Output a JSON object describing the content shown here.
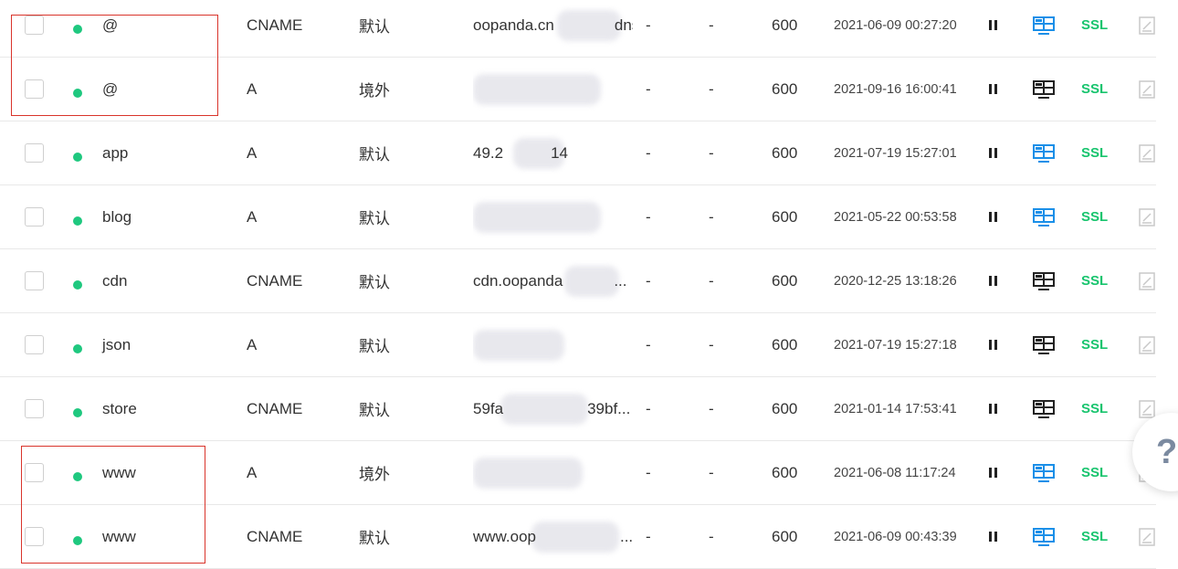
{
  "colors": {
    "status_dot": "#1fc87f",
    "ssl": "#18c46e",
    "monitor_active": "#1a8fe8",
    "monitor_inactive": "#222222",
    "highlight_box": "#d9342b",
    "edit_icon": "#c8c8c8",
    "help_icon": "#7b8aa0"
  },
  "icons": {
    "status": "status-dot-icon",
    "pause": "pause-icon",
    "monitor": "monitor-grid-icon",
    "edit": "edit-icon",
    "help": "question-mark-icon"
  },
  "ssl_label": "SSL",
  "help_label": "?",
  "records": [
    {
      "host": "@",
      "type": "CNAME",
      "line": "默认",
      "value": "oopanda.cn",
      "value_suffix": "dns...",
      "mx": "-",
      "weight": "-",
      "ttl": "600",
      "updated": "2021-06-09 00:27:20",
      "monitor_active": true
    },
    {
      "host": "@",
      "type": "A",
      "line": "境外",
      "value": "",
      "value_suffix": "",
      "mx": "-",
      "weight": "-",
      "ttl": "600",
      "updated": "2021-09-16 16:00:41",
      "monitor_active": false
    },
    {
      "host": "app",
      "type": "A",
      "line": "默认",
      "value": "49.2",
      "value_suffix": "14",
      "mx": "-",
      "weight": "-",
      "ttl": "600",
      "updated": "2021-07-19 15:27:01",
      "monitor_active": true
    },
    {
      "host": "blog",
      "type": "A",
      "line": "默认",
      "value": "",
      "value_suffix": "",
      "mx": "-",
      "weight": "-",
      "ttl": "600",
      "updated": "2021-05-22 00:53:58",
      "monitor_active": true
    },
    {
      "host": "cdn",
      "type": "CNAME",
      "line": "默认",
      "value": "cdn.oopanda",
      "value_suffix": "...",
      "mx": "-",
      "weight": "-",
      "ttl": "600",
      "updated": "2020-12-25 13:18:26",
      "monitor_active": false
    },
    {
      "host": "json",
      "type": "A",
      "line": "默认",
      "value": "",
      "value_suffix": "",
      "mx": "-",
      "weight": "-",
      "ttl": "600",
      "updated": "2021-07-19 15:27:18",
      "monitor_active": false
    },
    {
      "host": "store",
      "type": "CNAME",
      "line": "默认",
      "value": "59fa",
      "value_suffix": "39bf...",
      "mx": "-",
      "weight": "-",
      "ttl": "600",
      "updated": "2021-01-14 17:53:41",
      "monitor_active": false
    },
    {
      "host": "www",
      "type": "A",
      "line": "境外",
      "value": "",
      "value_suffix": "",
      "mx": "-",
      "weight": "-",
      "ttl": "600",
      "updated": "2021-06-08 11:17:24",
      "monitor_active": true
    },
    {
      "host": "www",
      "type": "CNAME",
      "line": "默认",
      "value": "www.oop",
      "value_suffix": "...",
      "mx": "-",
      "weight": "-",
      "ttl": "600",
      "updated": "2021-06-09 00:43:39",
      "monitor_active": true
    }
  ]
}
